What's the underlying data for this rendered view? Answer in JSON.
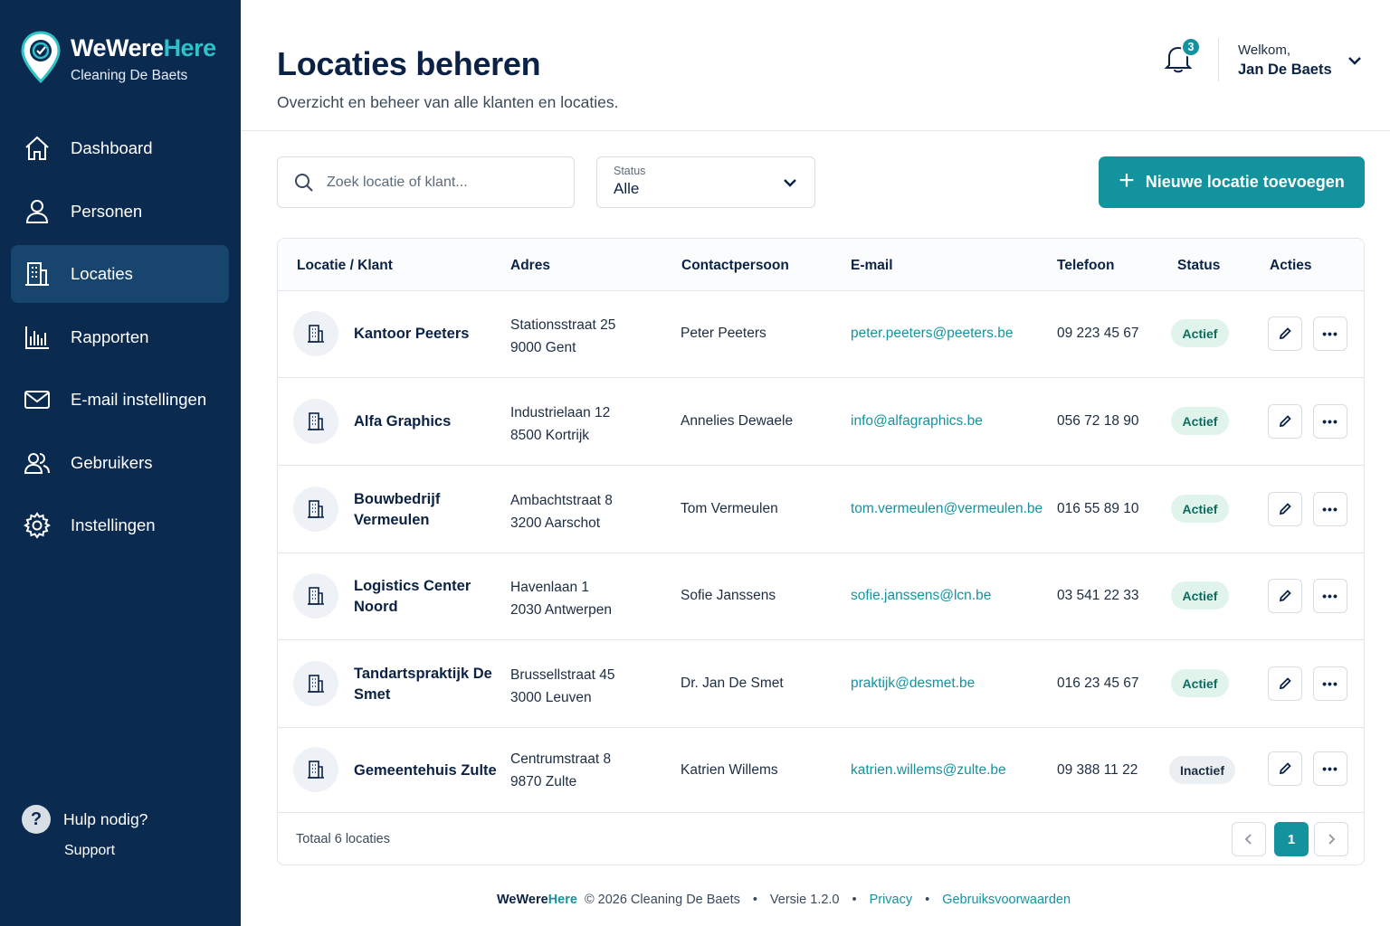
{
  "brand": {
    "name_part1": "WeWere",
    "name_part2": "Here",
    "subtitle": "Cleaning De Baets",
    "accent_color": "#2fc2c9"
  },
  "sidebar": {
    "items": [
      {
        "label": "Dashboard",
        "icon": "home-icon",
        "active": false
      },
      {
        "label": "Personen",
        "icon": "person-icon",
        "active": false
      },
      {
        "label": "Locaties",
        "icon": "building-icon",
        "active": true
      },
      {
        "label": "Rapporten",
        "icon": "bar-chart-icon",
        "active": false
      },
      {
        "label": "E-mail instellingen",
        "icon": "mail-icon",
        "active": false
      },
      {
        "label": "Gebruikers",
        "icon": "users-icon",
        "active": false
      },
      {
        "label": "Instellingen",
        "icon": "gear-icon",
        "active": false
      }
    ],
    "help": {
      "title": "Hulp nodig?",
      "link": "Support"
    }
  },
  "header": {
    "title": "Locaties beheren",
    "subtitle": "Overzicht en beheer van alle klanten en locaties.",
    "notifications_count": "3",
    "welcome_label": "Welkom,",
    "user_name": "Jan De Baets"
  },
  "toolbar": {
    "search_placeholder": "Zoek locatie of klant...",
    "status_label": "Status",
    "status_value": "Alle",
    "add_button": "Nieuwe locatie toevoegen"
  },
  "table": {
    "columns": [
      "Locatie / Klant",
      "Adres",
      "Contactpersoon",
      "E-mail",
      "Telefoon",
      "Status",
      "Acties"
    ],
    "rows": [
      {
        "name": "Kantoor Peeters",
        "street": "Stationsstraat 25",
        "city": "9000 Gent",
        "contact": "Peter Peeters",
        "email": "peter.peeters@peeters.be",
        "phone": "09 223 45 67",
        "status": "Actief"
      },
      {
        "name": "Alfa Graphics",
        "street": "Industrielaan 12",
        "city": "8500 Kortrijk",
        "contact": "Annelies Dewaele",
        "email": "info@alfagraphics.be",
        "phone": "056 72 18 90",
        "status": "Actief"
      },
      {
        "name": "Bouwbedrijf Vermeulen",
        "street": "Ambachtstraat 8",
        "city": "3200 Aarschot",
        "contact": "Tom Vermeulen",
        "email": "tom.vermeulen@vermeulen.be",
        "phone": "016 55 89 10",
        "status": "Actief"
      },
      {
        "name": "Logistics Center Noord",
        "street": "Havenlaan 1",
        "city": "2030 Antwerpen",
        "contact": "Sofie Janssens",
        "email": "sofie.janssens@lcn.be",
        "phone": "03 541 22 33",
        "status": "Actief"
      },
      {
        "name": "Tandartspraktijk De Smet",
        "street": "Brussellstraat 45",
        "city": "3000 Leuven",
        "contact": "Dr. Jan De Smet",
        "email": "praktijk@desmet.be",
        "phone": "016 23 45 67",
        "status": "Actief"
      },
      {
        "name": "Gemeentehuis Zulte",
        "street": "Centrumstraat 8",
        "city": "9870 Zulte",
        "contact": "Katrien Willems",
        "email": "katrien.willems@zulte.be",
        "phone": "09 388 11 22",
        "status": "Inactief"
      }
    ],
    "total_text": "Totaal 6 locaties",
    "current_page": "1"
  },
  "footer": {
    "brand_part1": "WeWere",
    "brand_part2": "Here",
    "copyright": "© 2026 Cleaning De Baets",
    "version": "Versie 1.2.0",
    "privacy": "Privacy",
    "terms": "Gebruiksvoorwaarden"
  },
  "colors": {
    "sidebar_bg": "#0b2a4f",
    "primary": "#14939e",
    "active_badge_bg": "#e0f4ec"
  }
}
